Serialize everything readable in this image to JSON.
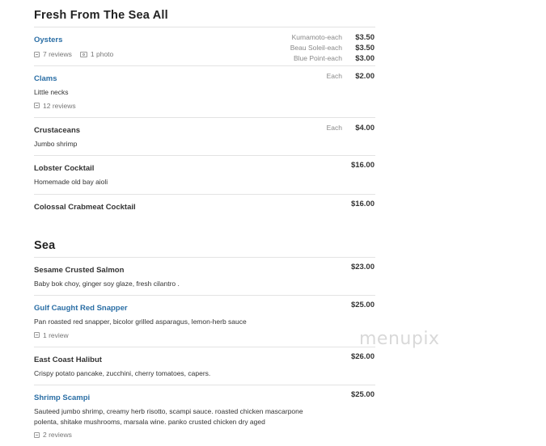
{
  "sections": [
    {
      "title": "Fresh From The Sea All",
      "items": [
        {
          "name": "Oysters",
          "reviews": "7 reviews",
          "photos": "1 photo",
          "prices": [
            {
              "label": "Kumamoto-each",
              "price": "$3.50"
            },
            {
              "label": "Beau Soleil-each",
              "price": "$3.50"
            },
            {
              "label": "Blue Point-each",
              "price": "$3.00"
            }
          ]
        },
        {
          "name": "Clams",
          "description": "Little necks",
          "reviews": "12 reviews",
          "prices": [
            {
              "label": "Each",
              "price": "$2.00"
            }
          ]
        },
        {
          "name": "Crustaceans",
          "description": "Jumbo shrimp",
          "prices": [
            {
              "label": "Each",
              "price": "$4.00"
            }
          ]
        },
        {
          "name": "Lobster Cocktail",
          "description": "Homemade old bay aioli",
          "prices": [
            {
              "label": "",
              "price": "$16.00"
            }
          ]
        },
        {
          "name": "Colossal Crabmeat Cocktail",
          "prices": [
            {
              "label": "",
              "price": "$16.00"
            }
          ]
        }
      ]
    },
    {
      "title": "Sea",
      "items": [
        {
          "name": "Sesame Crusted Salmon",
          "description": "Baby bok choy, ginger soy glaze, fresh cilantro .",
          "prices": [
            {
              "label": "",
              "price": "$23.00"
            }
          ]
        },
        {
          "name": "Gulf Caught Red Snapper",
          "description": "Pan roasted red snapper, bicolor grilled asparagus, lemon-herb sauce",
          "reviews": "1 review",
          "prices": [
            {
              "label": "",
              "price": "$25.00"
            }
          ]
        },
        {
          "name": "East Coast Halibut",
          "description": "Crispy potato pancake, zucchini, cherry tomatoes, capers.",
          "prices": [
            {
              "label": "",
              "price": "$26.00"
            }
          ]
        },
        {
          "name": "Shrimp Scampi",
          "description": "Sauteed jumbo shrimp, creamy herb risotto, scampi sauce. roasted chicken mascarpone polenta, shitake mushrooms, marsala wine. panko crusted chicken dry aged",
          "reviews": "2 reviews",
          "prices": [
            {
              "label": "",
              "price": "$25.00"
            }
          ]
        }
      ]
    }
  ],
  "watermark": "menupix",
  "colors": {
    "link": "#2a6ea5",
    "divider": "#e3e3e3",
    "text": "#333333"
  }
}
